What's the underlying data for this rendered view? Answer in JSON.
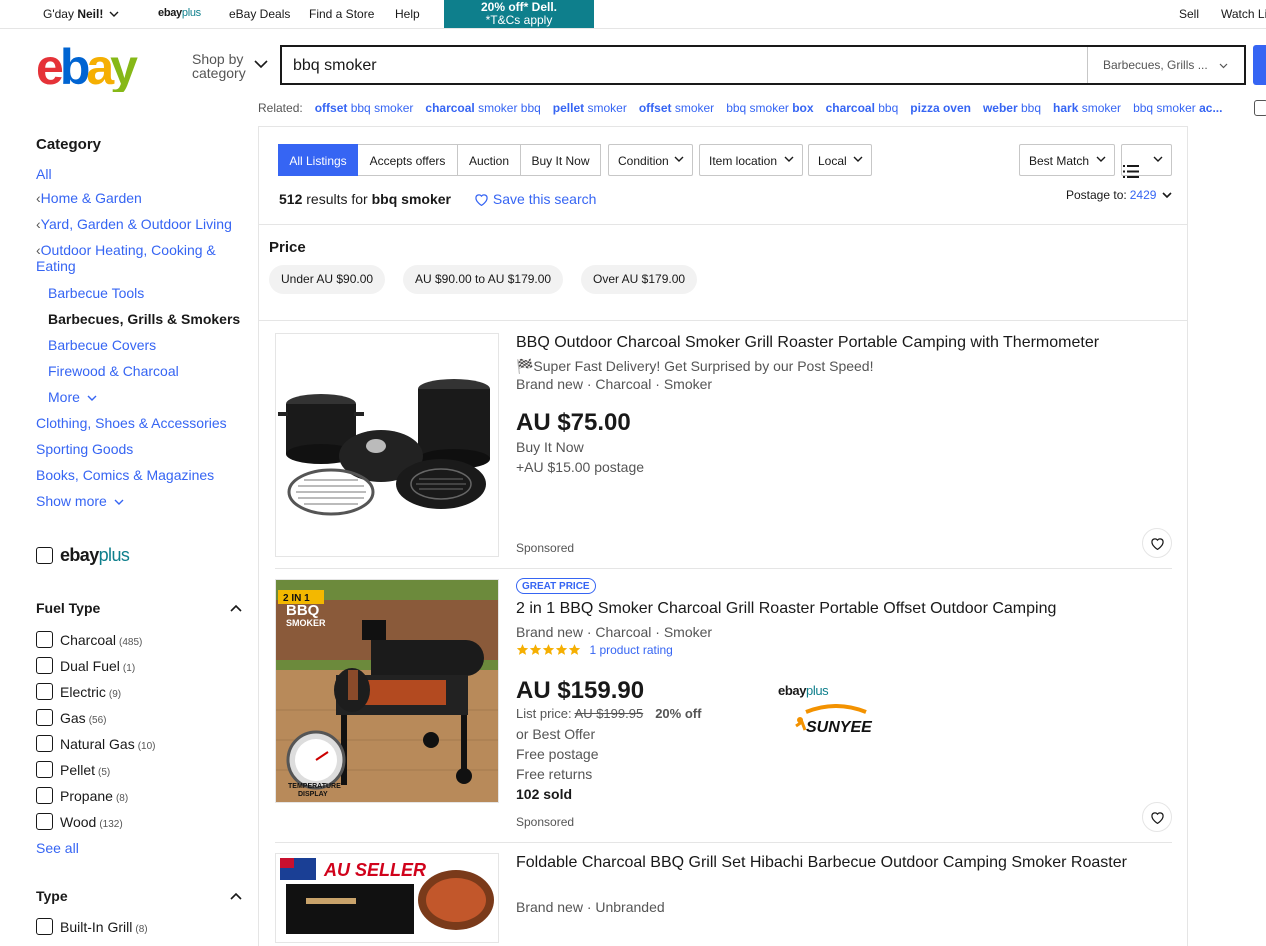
{
  "topbar": {
    "greeting": "G'day ",
    "user": "Neil!",
    "ebayplus_a": "ebay",
    "ebayplus_b": "plus",
    "deals": "eBay Deals",
    "store": "Find a Store",
    "help": "Help",
    "promo_line1": "20% off* Dell.",
    "promo_line2": "*T&Cs apply",
    "sell": "Sell",
    "watch": "Watch Li"
  },
  "header": {
    "shop_by_1": "Shop by",
    "shop_by_2": "category",
    "search_value": "bbq smoker",
    "search_category": "Barbecues, Grills ..."
  },
  "related": {
    "label": "Related:",
    "items": [
      {
        "b": "offset",
        "t": " bbq smoker"
      },
      {
        "b": "charcoal",
        "t": " smoker bbq"
      },
      {
        "b": "pellet",
        "t": " smoker"
      },
      {
        "b": "offset",
        "t": " smoker"
      },
      {
        "b": "",
        "t": "bbq smoker ",
        "b2": "box"
      },
      {
        "b": "charcoal",
        "t": " bbq"
      },
      {
        "b": "pizza oven",
        "t": ""
      },
      {
        "b": "weber",
        "t": " bbq"
      },
      {
        "b": "hark",
        "t": " smoker"
      },
      {
        "b": "",
        "t": "bbq smoker ",
        "b2": "ac..."
      }
    ]
  },
  "sidebar": {
    "category_heading": "Category",
    "cat_all": "All",
    "cat_home": "Home & Garden",
    "cat_yard": "Yard, Garden & Outdoor Living",
    "cat_outdoor_1": "Outdoor Heating, Cooking &",
    "cat_outdoor_2": "Eating",
    "cat_tools": "Barbecue Tools",
    "cat_current": "Barbecues, Grills & Smokers",
    "cat_covers": "Barbecue Covers",
    "cat_firewood": "Firewood & Charcoal",
    "cat_more": "More",
    "cat_clothing": "Clothing, Shoes & Accessories",
    "cat_sporting": "Sporting Goods",
    "cat_books": "Books, Comics & Magazines",
    "show_more": "Show more",
    "ebayplus_a": "ebay",
    "ebayplus_b": "plus",
    "fuel_heading": "Fuel Type",
    "fuel": [
      {
        "label": "Charcoal",
        "count": "(485)"
      },
      {
        "label": "Dual Fuel",
        "count": "(1)"
      },
      {
        "label": "Electric",
        "count": "(9)"
      },
      {
        "label": "Gas",
        "count": "(56)"
      },
      {
        "label": "Natural Gas",
        "count": "(10)"
      },
      {
        "label": "Pellet",
        "count": "(5)"
      },
      {
        "label": "Propane",
        "count": "(8)"
      },
      {
        "label": "Wood",
        "count": "(132)"
      }
    ],
    "see_all": "See all",
    "type_heading": "Type",
    "type_first": {
      "label": "Built-In Grill",
      "count": "(8)"
    }
  },
  "toolbar": {
    "tabs": [
      "All Listings",
      "Accepts offers",
      "Auction",
      "Buy It Now"
    ],
    "condition": "Condition",
    "location": "Item location",
    "local": "Local",
    "sort": "Best Match",
    "result_count": "512",
    "result_text": " results for ",
    "result_query": "bbq smoker",
    "save_search": "Save this search",
    "postage_label": "Postage to:",
    "postage_zip": "2429"
  },
  "price_filter": {
    "heading": "Price",
    "pills": [
      "Under AU $90.00",
      "AU $90.00 to AU $179.00",
      "Over AU $179.00"
    ]
  },
  "items": [
    {
      "title": "BBQ Outdoor Charcoal Smoker Grill Roaster Portable Camping with Thermometer",
      "subtitle": "🏁Super Fast Delivery! Get Surprised by our Post Speed!",
      "condition": "Brand new · Charcoal · Smoker",
      "price": "AU $75.00",
      "format": "Buy It Now",
      "postage": "+AU $15.00 postage",
      "sponsored": "Sponsored"
    },
    {
      "badge": "GREAT PRICE",
      "title": "2 in 1 BBQ Smoker Charcoal Grill Roaster Portable Offset Outdoor Camping",
      "condition": "Brand new · Charcoal · Smoker",
      "rating": 5,
      "rating_text": "1 product rating",
      "price": "AU $159.90",
      "list_label": "List price: ",
      "list_price": "AU $199.95",
      "discount": "20% off",
      "best_offer": "or Best Offer",
      "postage": "Free postage",
      "returns": "Free returns",
      "sold": "102 sold",
      "seller_logo": "SUNYEE",
      "img_text_1": "2 IN 1",
      "img_text_2": "BBQ",
      "img_text_3": "SMOKER",
      "img_text_4": "TEMPERATURE",
      "img_text_5": "DISPLAY",
      "sponsored": "Sponsored"
    },
    {
      "title": "Foldable Charcoal BBQ Grill Set Hibachi Barbecue Outdoor Camping Smoker Roaster",
      "condition": "Brand new · Unbranded",
      "img_text": "AU SELLER"
    }
  ],
  "colors": {
    "accent": "#3665f3",
    "promo": "#0e7f8c",
    "ebay_red": "#e53238",
    "ebay_blue": "#0064d2",
    "ebay_yellow": "#f5af02",
    "ebay_green": "#86b817"
  }
}
